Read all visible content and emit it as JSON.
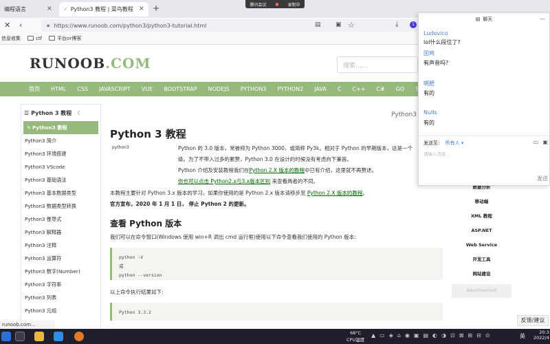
{
  "browser": {
    "tabs": [
      {
        "label": "编程语言"
      },
      {
        "label": "Python3 教程 | 菜鸟教程"
      }
    ],
    "new_tab": "+",
    "url": "https://www.runoob.com/python3/python3-tutorial.html",
    "meeting": {
      "app": "腾讯会议",
      "recording": "录制中"
    },
    "bookmarks": [
      {
        "label": "信息收集"
      },
      {
        "label": "ctf"
      },
      {
        "label": "平台or博客"
      }
    ]
  },
  "site": {
    "logo_main": "RUNOOB",
    "logo_suffix": ".COM",
    "search_placeholder": "搜索……",
    "nav": [
      "首页",
      "HTML",
      "CSS",
      "JAVASCRIPT",
      "VUE",
      "BOOTSTRAP",
      "NODEJS",
      "PYTHON3",
      "PYTHON2",
      "JAVA",
      "C",
      "C++",
      "C#",
      "GO",
      "SQL"
    ]
  },
  "sidebar": {
    "title": "Python 3 教程",
    "items": [
      "Python3 教程",
      "Python3 简介",
      "Python3 环境搭建",
      "Python3 VScode",
      "Python3 基础语法",
      "Python3 基本数据类型",
      "Python3 数据类型转换",
      "Python3 推导式",
      "Python3 解释器",
      "Python3 注释",
      "Python3 运算符",
      "Python3 数字(Number)",
      "Python3 字符串",
      "Python3 列表",
      "Python3 元组"
    ]
  },
  "main": {
    "crumb": "Python3 教",
    "title": "Python 3 教程",
    "img_label": "python3",
    "para1": "Python 的 3.0 版本，常被称为 Python 3000，或简称 Py3k。相对于 Python 的早期版本，这是一个",
    "para1b": "级。为了不带入过多的累赘，Python 3.0 在设计的时候没有考虑向下兼容。",
    "para2_pre": "Python 介绍及安装教程我们在",
    "para2_link": "Python 2.X 版本的教程",
    "para2_post": "中已有介绍，这里就不再赘述。",
    "para3_link": "你也可以点击 Python2.x与3.x版本区别",
    "para3_post": " 来查看两者的不同。",
    "para4_pre": "本教程主要针对 Python 3.x 版本的学习，如果你使用的是 Python 2.x 版本请移步至 ",
    "para4_link": "Python 2.X 版本的教程",
    "para4_post": "。",
    "notice": "官方宣布，2020 年 1 月 1 日， 停止 Python 2 的更新。",
    "h2": "查看 Python 版本",
    "para5": "我们可以在命令窗口(Windows 使用 win+R 调出 cmd 运行框)使用以下命令查看我们使用的 Python 版本:",
    "code1": [
      "python -V",
      "或",
      "python --version"
    ],
    "para6": "以上命令执行结果如下:",
    "code2": "Python 3.3.2"
  },
  "rightcol": {
    "items": [
      "数据分析",
      "移动端",
      "XML 教程",
      "ASP.NET",
      "Web Service",
      "开发工具",
      "网站建设"
    ],
    "ad": "Advertisement"
  },
  "chat": {
    "title": "聊天",
    "messages": [
      {
        "name": "Ludovico",
        "text": "lol什么段位了?"
      },
      {
        "name": "团鸡",
        "text": "有声音吗?"
      },
      {
        "name": "啊肥",
        "text": "有的"
      },
      {
        "name": "Nulls",
        "text": "有的"
      }
    ],
    "send_to_label": "发送至:",
    "send_to_value": "所有人",
    "input_hint": "请输入消息...",
    "send_button": "发送"
  },
  "feedback": "反馈/建议",
  "status_url": "runoob.com...",
  "taskbar": {
    "weather": "68°C",
    "weather_sub": "CPU温度",
    "lang": "英",
    "time": "20:3",
    "date": "2022/4"
  }
}
